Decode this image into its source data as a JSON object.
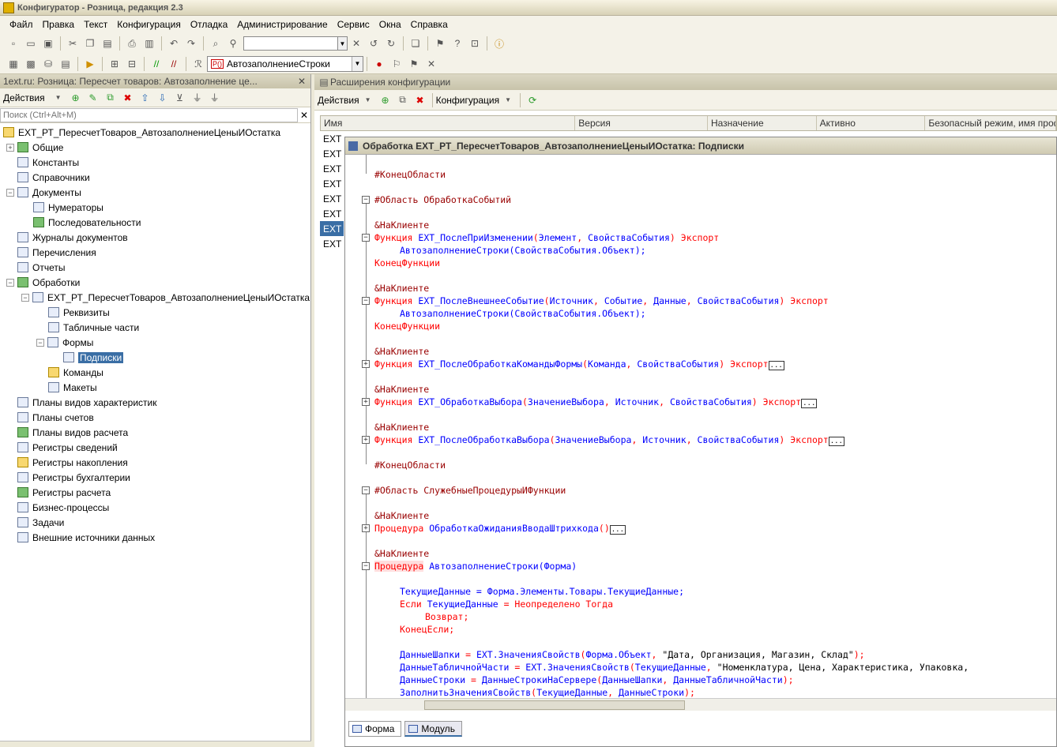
{
  "window": {
    "title": "Конфигуратор - Розница, редакция 2.3"
  },
  "menu": [
    "Файл",
    "Правка",
    "Текст",
    "Конфигурация",
    "Отладка",
    "Администрирование",
    "Сервис",
    "Окна",
    "Справка"
  ],
  "toolbar2": {
    "procedure_combo": "АвтозаполнениеСтроки",
    "combo_badge": "Р()"
  },
  "left_panel": {
    "title": "1ext.ru: Розница: Пересчет товаров: Автозаполнение це...",
    "actions_label": "Действия",
    "search_placeholder": "Поиск (Ctrl+Alt+M)",
    "clear_label": "✕",
    "tree": [
      {
        "label": "EXT_РТ_ПересчетТоваров_АвтозаполнениеЦеныИОстатка",
        "level": 0
      },
      {
        "label": "Общие",
        "level": 1
      },
      {
        "label": "Константы",
        "level": 1
      },
      {
        "label": "Справочники",
        "level": 1
      },
      {
        "label": "Документы",
        "level": 1
      },
      {
        "label": "Нумераторы",
        "level": 2
      },
      {
        "label": "Последовательности",
        "level": 2
      },
      {
        "label": "Журналы документов",
        "level": 1
      },
      {
        "label": "Перечисления",
        "level": 1
      },
      {
        "label": "Отчеты",
        "level": 1
      },
      {
        "label": "Обработки",
        "level": 1
      },
      {
        "label": "EXT_РТ_ПересчетТоваров_АвтозаполнениеЦеныИОстатка",
        "level": 2
      },
      {
        "label": "Реквизиты",
        "level": 3
      },
      {
        "label": "Табличные части",
        "level": 3
      },
      {
        "label": "Формы",
        "level": 3
      },
      {
        "label": "Подписки",
        "level": 4
      },
      {
        "label": "Команды",
        "level": 3
      },
      {
        "label": "Макеты",
        "level": 3
      },
      {
        "label": "Планы видов характеристик",
        "level": 1
      },
      {
        "label": "Планы счетов",
        "level": 1
      },
      {
        "label": "Планы видов расчета",
        "level": 1
      },
      {
        "label": "Регистры сведений",
        "level": 1
      },
      {
        "label": "Регистры накопления",
        "level": 1
      },
      {
        "label": "Регистры бухгалтерии",
        "level": 1
      },
      {
        "label": "Регистры расчета",
        "level": 1
      },
      {
        "label": "Бизнес-процессы",
        "level": 1
      },
      {
        "label": "Задачи",
        "level": 1
      },
      {
        "label": "Внешние источники данных",
        "level": 1
      }
    ]
  },
  "right_panel": {
    "title": "Расширения конфигурации",
    "actions_label": "Действия",
    "config_label": "Конфигурация",
    "columns": [
      "Имя",
      "Версия",
      "Назначение",
      "Активно",
      "Безопасный режим, имя профи"
    ],
    "rows": [
      "EXT",
      "EXT",
      "EXT",
      "EXT",
      "EXT",
      "EXT",
      "EXT",
      "EXT"
    ]
  },
  "module": {
    "title": "Обработка EXT_РТ_ПересчетТоваров_АвтозаполнениеЦеныИОстатка: Подписки",
    "tabs": [
      "Форма",
      "Модуль"
    ],
    "ellipsis": "...",
    "code": {
      "end_region": "#КонецОбласти",
      "region_events": "#Область ОбработкаСобытий",
      "ann": "&НаКлиенте",
      "f1": "Функция EXT_ПослеПриИзменении(Элемент, СвойстваСобытия) Экспорт",
      "f1_body": "АвтозаполнениеСтроки(СвойстваСобытия.Объект);",
      "end_func": "КонецФункции",
      "f2": "Функция EXT_ПослеВнешнееСобытие(Источник, Событие, Данные, СвойстваСобытия) Экспорт",
      "f2_body": "АвтозаполнениеСтроки(СвойстваСобытия.Объект);",
      "f3": "Функция EXT_ПослеОбработкаКомандыФормы(Команда, СвойстваСобытия) Экспорт",
      "f4": "Функция EXT_ОбработкаВыбора(ЗначениеВыбора, Источник, СвойстваСобытия) Экспорт",
      "f5": "Функция EXT_ПослеОбработкаВыбора(ЗначениеВыбора, Источник, СвойстваСобытия) Экспорт",
      "region_service": "#Область СлужебныеПроцедурыИФункции",
      "p1": "Процедура ОбработкаОжиданияВводаШтрихкода()",
      "p2_kw": "Процедура",
      "p2_rest": " АвтозаполнениеСтроки(Форма)",
      "b1": "ТекущиеДанные = Форма.Элементы.Товары.ТекущиеДанные;",
      "b2": "Если ТекущиеДанные = Неопределено Тогда",
      "b3": "Возврат;",
      "b4": "КонецЕсли;",
      "b5": "ДанныеШапки = EXT.ЗначенияСвойств(Форма.Объект, \"Дата, Организация, Магазин, Склад\");",
      "b6": "ДанныеТабличнойЧасти = EXT.ЗначенияСвойств(ТекущиеДанные, \"Номенклатура, Цена, Характеристика, Упаковка,",
      "b7": "ДанныеСтроки = ДанныеСтрокиНаСервере(ДанныеШапки, ДанныеТабличнойЧасти);",
      "b8": "ЗаполнитьЗначенияСвойств(ТекущиеДанные, ДанныеСтроки);"
    }
  }
}
